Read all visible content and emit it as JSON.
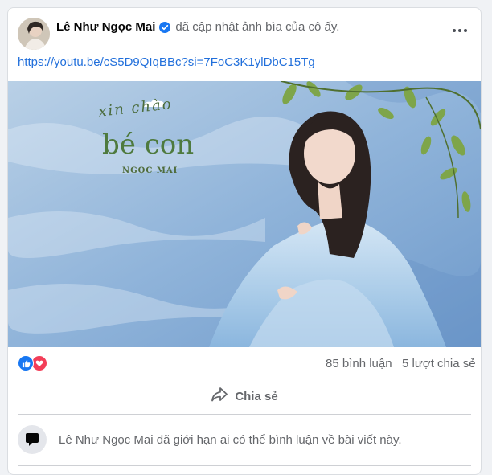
{
  "post": {
    "author": "Lê Như Ngọc Mai",
    "action": "đã cập nhật ảnh bìa của cô ấy.",
    "link": "https://youtu.be/cS5D9QIqBBc?si=7FoC3K1ylDbC15Tg"
  },
  "cover": {
    "title_small": "xin chào",
    "title_big": "bé con",
    "artist": "NGỌC MAI"
  },
  "stats": {
    "reactions": [
      "like-icon",
      "love-icon"
    ],
    "comments": "85 bình luận",
    "shares": "5 lượt chia sẻ"
  },
  "actions": {
    "share_label": "Chia sẻ"
  },
  "comment_notice": "Lê Như Ngọc Mai đã giới hạn ai có thể bình luận về bài viết này.",
  "colors": {
    "link": "#216fdb",
    "like": "#1877f2",
    "love": "#f33e58",
    "muted": "#65676b"
  }
}
